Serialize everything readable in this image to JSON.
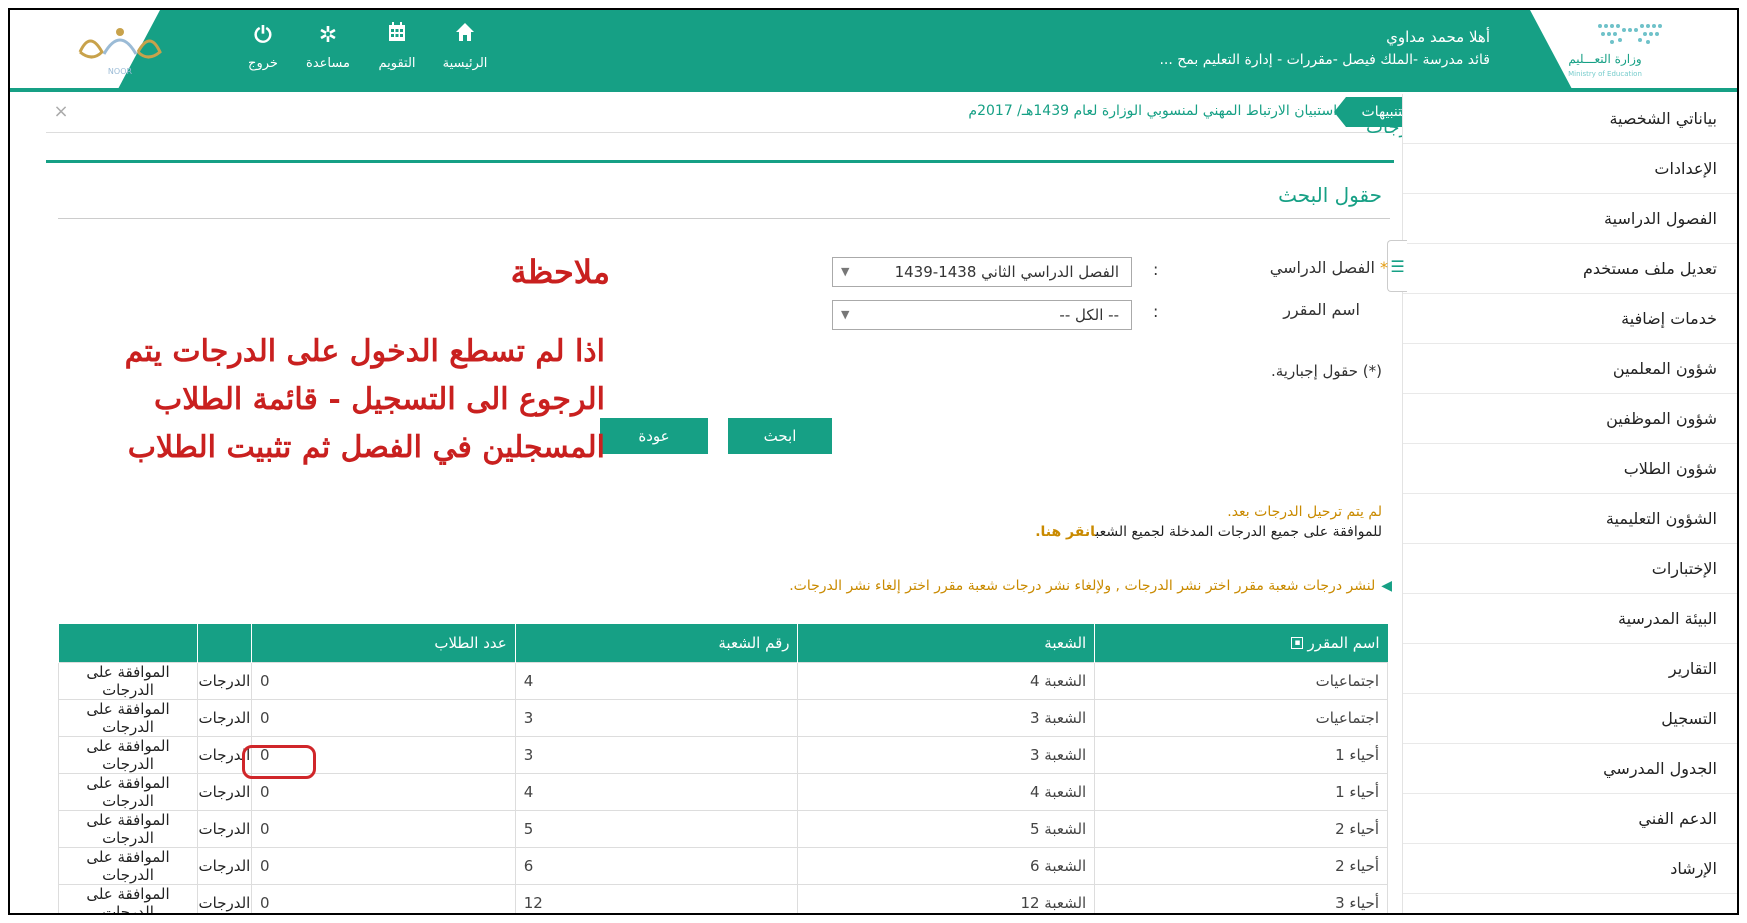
{
  "header": {
    "user_greeting": "أهلا محمد مداوي",
    "user_role": "قائد مدرسة -الملك فيصل -مقررات - إدارة التعليم بمح ...",
    "noor_logo_text": "NOOR",
    "moe_logo_text": "وزارة التعـــليم",
    "moe_logo_sub": "Ministry of Education",
    "nav": {
      "home": "الرئيسية",
      "calendar": "التقويم",
      "help": "مساعدة",
      "logout": "خروج"
    }
  },
  "notifications": {
    "label": "التنبيهات",
    "text": ". استبيان الارتباط المهني لمنسوبي الوزارة لعام 1439هـ/ 2017م",
    "close": "×",
    "page_title": "الدرجات"
  },
  "sidebar": {
    "items": [
      {
        "label": "بياناتي الشخصية"
      },
      {
        "label": "الإعدادات"
      },
      {
        "label": "الفصول الدراسية"
      },
      {
        "label": "تعديل ملف مستخدم"
      },
      {
        "label": "خدمات إضافية"
      },
      {
        "label": "شؤون المعلمين"
      },
      {
        "label": "شؤون الموظفين"
      },
      {
        "label": "شؤون الطلاب"
      },
      {
        "label": "الشؤون التعليمية"
      },
      {
        "label": "الإختبارات"
      },
      {
        "label": "البيئة المدرسية"
      },
      {
        "label": "التقارير"
      },
      {
        "label": "التسجيل"
      },
      {
        "label": "الجدول المدرسي"
      },
      {
        "label": "الدعم الفني"
      },
      {
        "label": "الإرشاد"
      }
    ]
  },
  "search": {
    "title": "حقول البحث",
    "semester_label": "الفصل الدراسي",
    "semester_value": "الفصل الدراسي الثاني 1438-1439",
    "course_label": "اسم المقرر",
    "course_value": "-- الكل --",
    "required_note": "(*) حقول إجبارية.",
    "search_button": "ابحث",
    "back_button": "عودة"
  },
  "annotation": {
    "title": "ملاحظة",
    "body": "اذا لم تسطع الدخول على الدرجات يتم الرجوع الى التسجيل - قائمة الطلاب المسجلين في الفصل ثم تثبيت الطلاب"
  },
  "messages": {
    "not_posted": "لم يتم ترحيل الدرجات بعد.",
    "approve_text": "للموافقة على جميع الدرجات المدخلة لجميع الشعب",
    "approve_link": "انقر هنا.",
    "publish_info": "لنشر درجات شعبة مقرر اختر نشر الدرجات , ولإلغاء نشر درجات شعبة مقرر اختر إلغاء نشر الدرجات."
  },
  "table": {
    "headers": {
      "course": "اسم المقرر",
      "section": "الشعبة",
      "section_no": "رقم الشعبة",
      "students": "عدد الطلاب",
      "grades": "",
      "approve": ""
    },
    "rows": [
      {
        "course": "اجتماعيات",
        "section": "الشعبة 4",
        "section_no": "4",
        "students": "0",
        "grades": "الدرجات",
        "approve": "الموافقة على الدرجات"
      },
      {
        "course": "اجتماعيات",
        "section": "الشعبة 3",
        "section_no": "3",
        "students": "0",
        "grades": "الدرجات",
        "approve": "الموافقة على الدرجات"
      },
      {
        "course": "أحياء 1",
        "section": "الشعبة 3",
        "section_no": "3",
        "students": "0",
        "grades": "الدرجات",
        "approve": "الموافقة على الدرجات"
      },
      {
        "course": "أحياء 1",
        "section": "الشعبة 4",
        "section_no": "4",
        "students": "0",
        "grades": "الدرجات",
        "approve": "الموافقة على الدرجات"
      },
      {
        "course": "أحياء 2",
        "section": "الشعبة 5",
        "section_no": "5",
        "students": "0",
        "grades": "الدرجات",
        "approve": "الموافقة على الدرجات"
      },
      {
        "course": "أحياء 2",
        "section": "الشعبة 6",
        "section_no": "6",
        "students": "0",
        "grades": "الدرجات",
        "approve": "الموافقة على الدرجات"
      },
      {
        "course": "أحياء 3",
        "section": "الشعبة 12",
        "section_no": "12",
        "students": "0",
        "grades": "الدرجات",
        "approve": "الموافقة على الدرجات"
      }
    ]
  },
  "colors": {
    "accent": "#16a085",
    "warning": "#c98a00",
    "annotation": "#c9201f"
  },
  "icons": {
    "home": "home-icon",
    "calendar": "calendar-icon",
    "help": "gear-icon",
    "logout": "power-icon"
  }
}
